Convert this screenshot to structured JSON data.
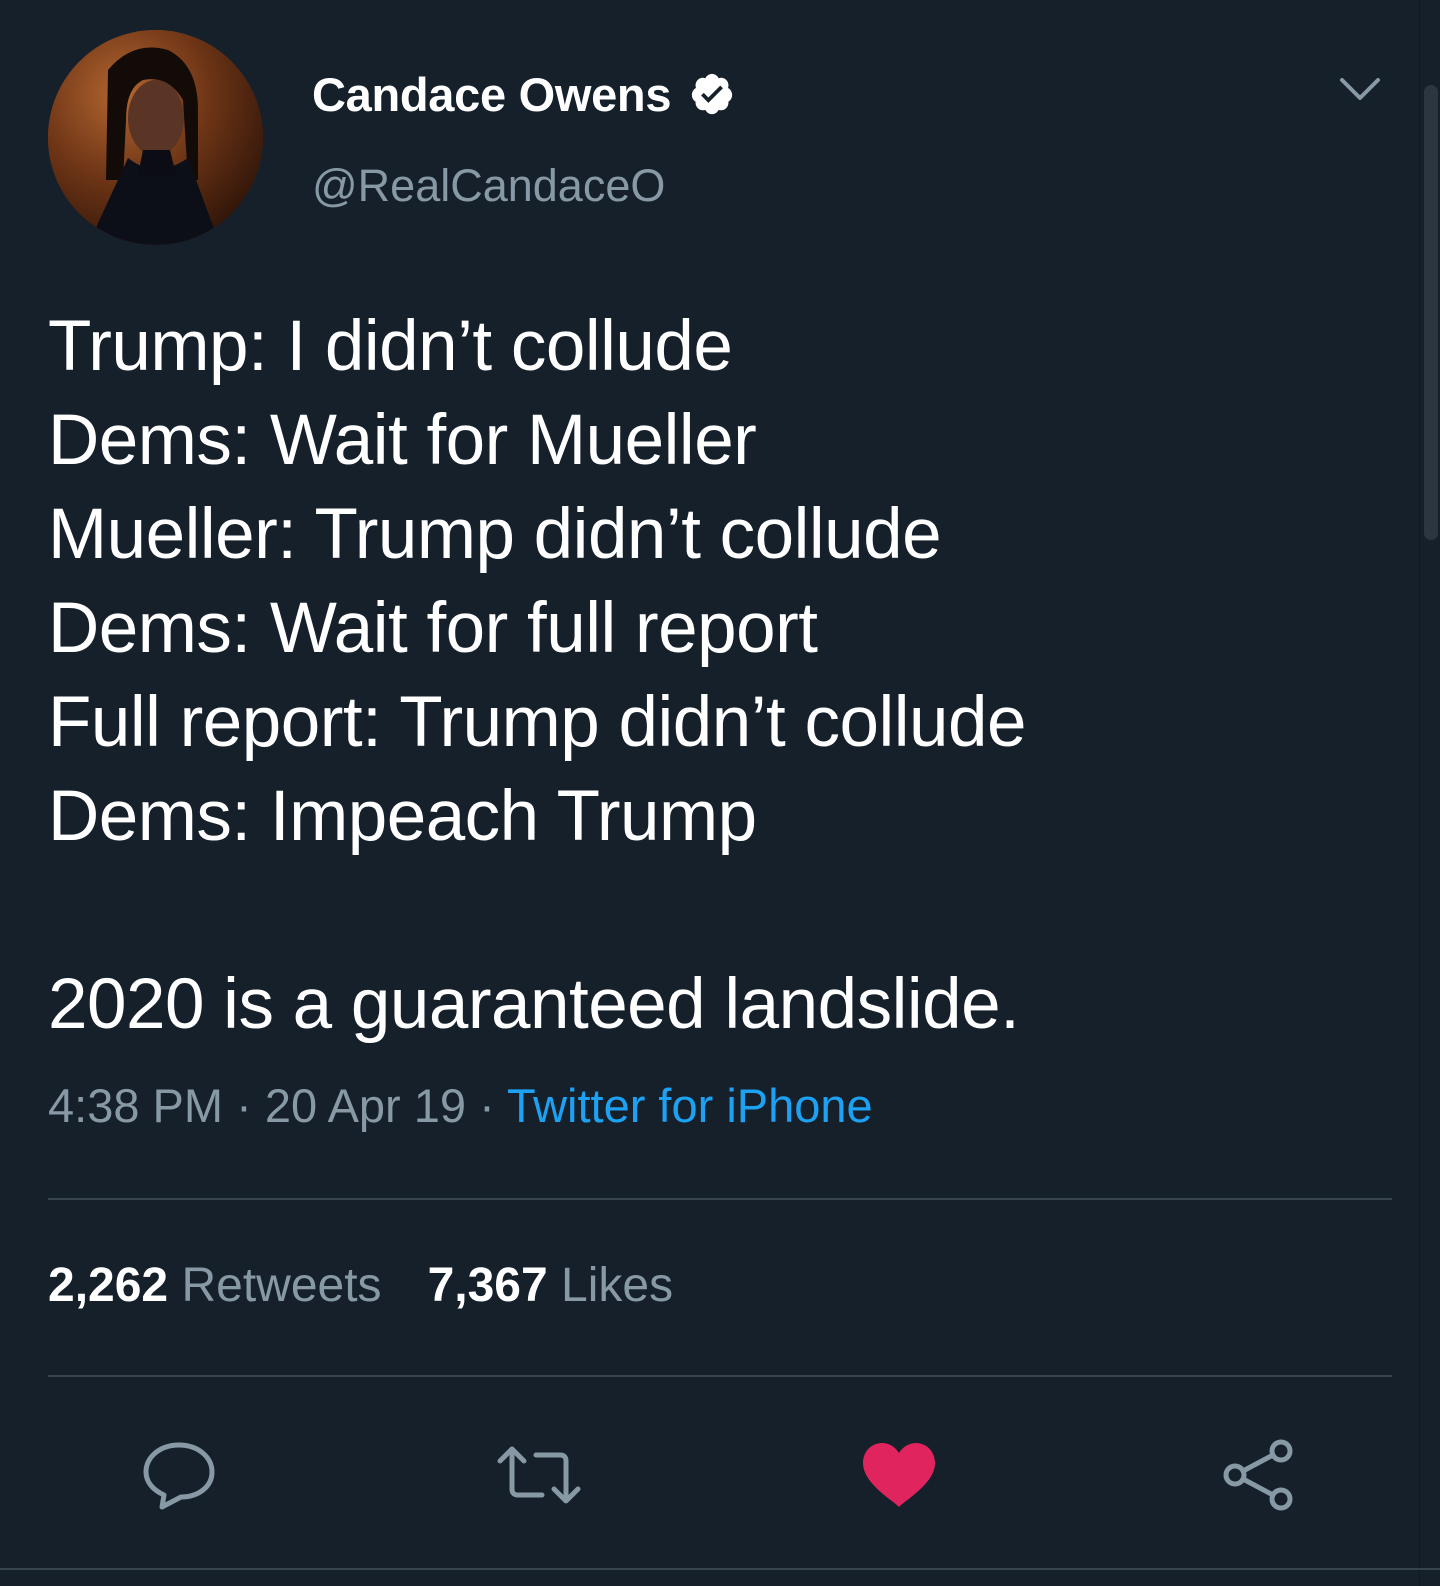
{
  "tweet": {
    "author": {
      "display_name": "Candace Owens",
      "handle": "@RealCandaceO",
      "verified": true,
      "avatar_icon": "profile-photo"
    },
    "text_lines": [
      "Trump: I didn’t collude",
      "Dems: Wait for Mueller",
      "Mueller: Trump didn’t collude",
      "Dems: Wait for full report",
      "Full report: Trump didn’t collude",
      "Dems: Impeach Trump"
    ],
    "closing_line": "2020 is a guaranteed landslide.",
    "time": "4:38 PM",
    "date": "20 Apr 19",
    "separator": " · ",
    "source": "Twitter for iPhone",
    "stats": {
      "retweets_count": "2,262",
      "retweets_label": "Retweets",
      "likes_count": "7,367",
      "likes_label": "Likes"
    },
    "actions": [
      {
        "name": "reply",
        "icon": "comment-bubble-icon"
      },
      {
        "name": "retweet",
        "icon": "retweet-arrows-icon"
      },
      {
        "name": "like",
        "icon": "heart-icon",
        "active": true
      },
      {
        "name": "share",
        "icon": "share-nodes-icon"
      }
    ]
  },
  "colors": {
    "background": "#15202b",
    "primary_text": "#ffffff",
    "secondary_text": "#8899a6",
    "link": "#1da1f2",
    "divider": "#38444d",
    "like_active": "#e0245e",
    "verified_badge": "#ffffff"
  }
}
